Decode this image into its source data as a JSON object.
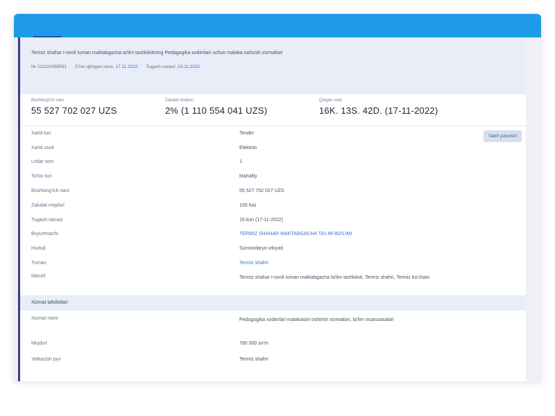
{
  "header": {
    "description": "Termiz shahar I-sonli tuman maktabgacha ta'lim tashkilotining Pedagogika xodimlari uchun malaka oshirish xizmatlari",
    "id": "№ 221110068591",
    "published_label": "Eʻlon qilingan sana:",
    "published_value": "17.11.2022",
    "end_label": "Tugash sanasi:",
    "end_value": "23.11.2022"
  },
  "stats": [
    {
      "label": "Boshlang'ich narx",
      "value": "55 527 702 027 UZS"
    },
    {
      "label": "Zakalat miqdori",
      "value": "2% (1 110 554 041 UZS)"
    },
    {
      "label": "Qolgan vaqt",
      "value": "16K.  13S.  42D.  (17-11-2022)"
    }
  ],
  "details_button": "Taklif yuborish",
  "details": [
    {
      "key": "Xarid turi",
      "value": "Tender",
      "link": false
    },
    {
      "key": "Xarid usuli",
      "value": "Elektron",
      "link": false
    },
    {
      "key": "Lotlar soni",
      "value": "1",
      "link": false
    },
    {
      "key": "To'lov turi",
      "value": "Mahalliy",
      "link": false
    },
    {
      "key": "Boshlang'ich narx",
      "value": "55 527 702 027 UZS",
      "link": false
    },
    {
      "key": "Zakalat miqdori",
      "value": "100 foiz",
      "link": false
    },
    {
      "key": "Tugash sanasi",
      "value": "16 kun (17-11-2022)",
      "link": false
    },
    {
      "key": "Buyurtmachi",
      "value": "TERMIZ SHAHAR MAKTABGACHA TA'LIM BO'LIMI",
      "link": true
    },
    {
      "key": "Hudud",
      "value": "Surxondaryo viloyati",
      "link": false
    },
    {
      "key": "Tuman",
      "value": "Termiz shahri",
      "link": true
    },
    {
      "key": "Manzil",
      "value": "Termiz shahar I-sonli tuman maktabgacha ta'lim tashkiloti, Termiz shahri, Termiz ko'chasi",
      "link": false
    }
  ],
  "section2_title": "Xizmat tafsilotlari",
  "details2": [
    {
      "key": "Xizmat nomi",
      "value": "Pedagogika xodimlari malakasini oshirish xizmatlari, ta'lim muassasalari",
      "link": false,
      "tall": true
    },
    {
      "key": "Miqdori",
      "value": "780 000 so'm",
      "link": false,
      "tall": false
    },
    {
      "key": "Yetkazish joyi",
      "value": "Termiz shahri",
      "link": false,
      "tall": false
    }
  ]
}
